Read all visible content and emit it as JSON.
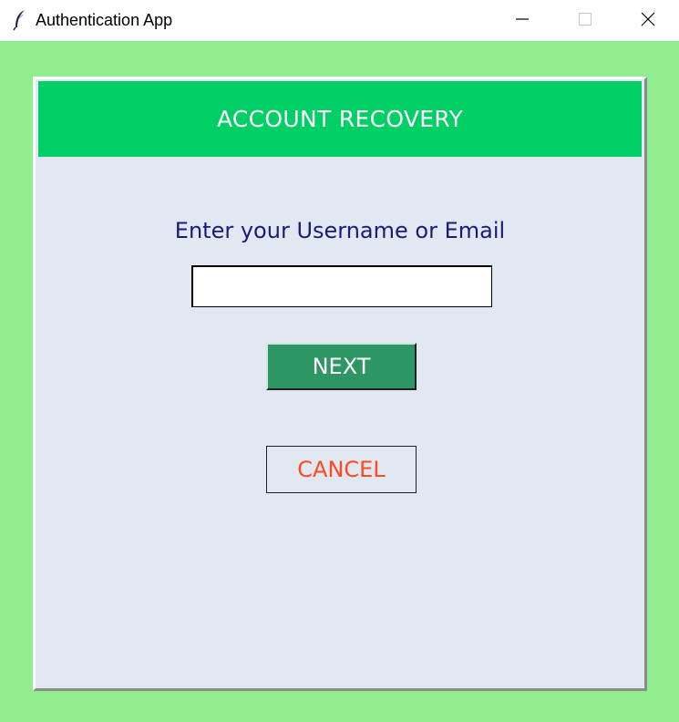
{
  "window": {
    "title": "Authentication App",
    "icon": "feather-icon"
  },
  "header": {
    "title": "ACCOUNT RECOVERY"
  },
  "form": {
    "prompt": "Enter your Username or Email",
    "input_value": ""
  },
  "buttons": {
    "next_label": "NEXT",
    "cancel_label": "CANCEL"
  },
  "colors": {
    "background": "#90ee90",
    "header": "#00cf66",
    "panel": "#e1e8f2",
    "next_button": "#2e9664",
    "cancel_text": "#ff4a1c",
    "prompt_text": "#1b1b7a"
  }
}
